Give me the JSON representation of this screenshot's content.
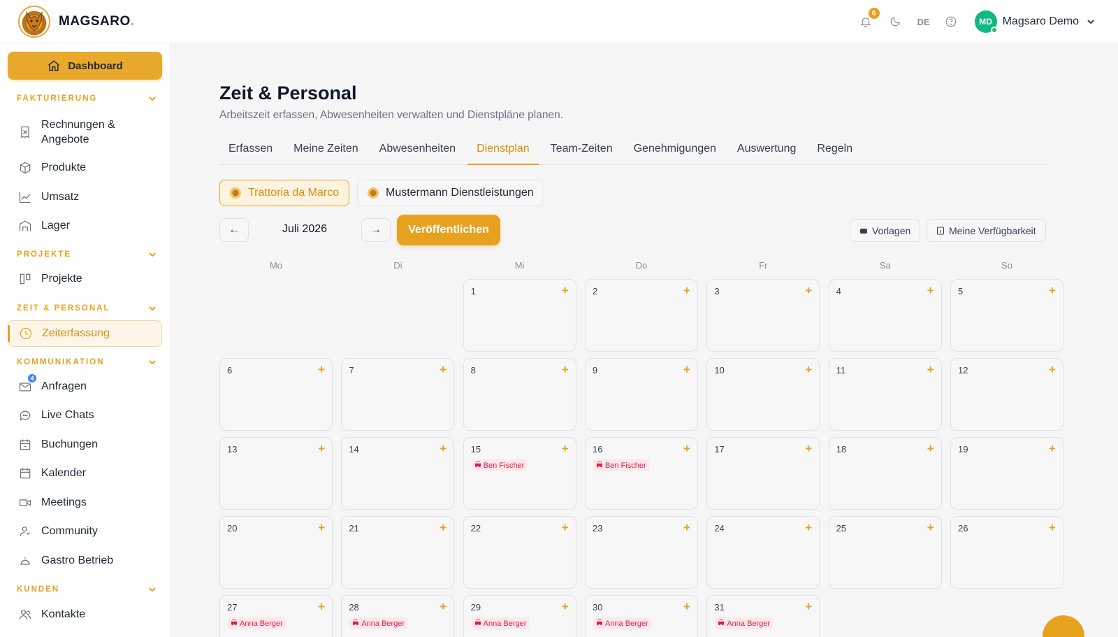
{
  "brand": {
    "name": "MAGSARO",
    "dot": "."
  },
  "topbar": {
    "notifications_count": "6",
    "language": "DE",
    "user_initials": "MD",
    "user_name": "Magsaro Demo"
  },
  "sidebar": {
    "dashboard_label": "Dashboard",
    "sections": [
      {
        "title": "FAKTURIERUNG",
        "items": [
          "Rechnungen & Angebote",
          "Produkte",
          "Umsatz",
          "Lager"
        ]
      },
      {
        "title": "PROJEKTE",
        "items": [
          "Projekte"
        ]
      },
      {
        "title": "ZEIT & PERSONAL",
        "items": [
          "Zeiterfassung"
        ]
      },
      {
        "title": "KOMMUNIKATION",
        "items": [
          "Anfragen",
          "Live Chats",
          "Buchungen",
          "Kalender",
          "Meetings",
          "Community",
          "Gastro Betrieb"
        ]
      },
      {
        "title": "KUNDEN",
        "items": [
          "Kontakte"
        ]
      }
    ],
    "rechnungen_line1": "Rechnungen &",
    "rechnungen_line2": "Angebote",
    "anfragen_badge": "4"
  },
  "page": {
    "title": "Zeit & Personal",
    "subtitle": "Arbeitszeit erfassen, Abwesenheiten verwalten und Dienstpläne planen.",
    "tabs": [
      "Erfassen",
      "Meine Zeiten",
      "Abwesenheiten",
      "Dienstplan",
      "Team-Zeiten",
      "Genehmigungen",
      "Auswertung",
      "Regeln"
    ],
    "active_tab": "Dienstplan",
    "businesses": [
      "Trattoria da Marco",
      "Mustermann Dienstleistungen"
    ],
    "month_label": "Juli 2026",
    "prev_label": "←",
    "next_label": "→",
    "publish_label": "Veröffentlichen",
    "templates_label": "Vorlagen",
    "availability_label": "Meine Verfügbarkeit",
    "weekdays": [
      "Mo",
      "Di",
      "Mi",
      "Do",
      "Fr",
      "Sa",
      "So"
    ],
    "plus": "+"
  },
  "calendar": {
    "weeks": [
      [
        null,
        null,
        {
          "d": "1"
        },
        {
          "d": "2"
        },
        {
          "d": "3"
        },
        {
          "d": "4"
        },
        {
          "d": "5"
        }
      ],
      [
        {
          "d": "6"
        },
        {
          "d": "7"
        },
        {
          "d": "8"
        },
        {
          "d": "9"
        },
        {
          "d": "10"
        },
        {
          "d": "11"
        },
        {
          "d": "12"
        }
      ],
      [
        {
          "d": "13"
        },
        {
          "d": "14"
        },
        {
          "d": "15",
          "shift": "Ben Fischer"
        },
        {
          "d": "16",
          "shift": "Ben Fischer"
        },
        {
          "d": "17"
        },
        {
          "d": "18"
        },
        {
          "d": "19"
        }
      ],
      [
        {
          "d": "20"
        },
        {
          "d": "21"
        },
        {
          "d": "22"
        },
        {
          "d": "23"
        },
        {
          "d": "24"
        },
        {
          "d": "25"
        },
        {
          "d": "26"
        }
      ],
      [
        {
          "d": "27",
          "shift": "Anna Berger"
        },
        {
          "d": "28",
          "shift": "Anna Berger"
        },
        {
          "d": "29",
          "shift": "Anna Berger"
        },
        {
          "d": "30",
          "shift": "Anna Berger"
        },
        {
          "d": "31",
          "shift": "Anna Berger"
        },
        null,
        null
      ]
    ]
  },
  "colors": {
    "accent": "#e6a21f",
    "shift_bg": "#fde8ea",
    "shift_text": "#e11d48",
    "online": "#10b981"
  }
}
